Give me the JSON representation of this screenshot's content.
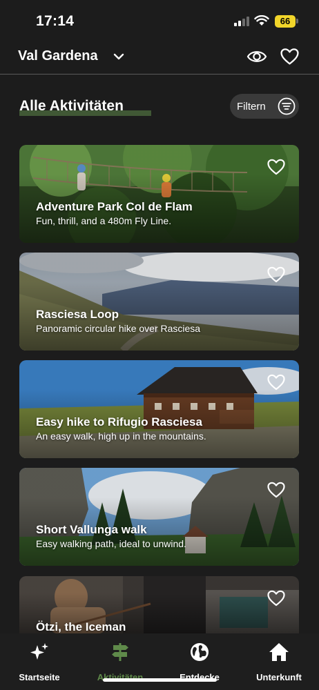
{
  "status_bar": {
    "time": "17:14",
    "battery": "66"
  },
  "header": {
    "location": "Val Gardena"
  },
  "main": {
    "title": "Alle Aktivitäten",
    "filter_label": "Filtern",
    "cards": [
      {
        "title": "Adventure Park Col de Flam",
        "subtitle": "Fun, thrill, and a 480m Fly Line."
      },
      {
        "title": "Rasciesa Loop",
        "subtitle": "Panoramic circular hike over Rasciesa"
      },
      {
        "title": "Easy hike to Rifugio Rasciesa",
        "subtitle": "An easy walk, high up in the mountains."
      },
      {
        "title": "Short Vallunga walk",
        "subtitle": "Easy walking path, ideal to unwind."
      },
      {
        "title": "Ötzi, the Iceman",
        "subtitle": ""
      }
    ]
  },
  "nav": {
    "items": [
      {
        "label": "Startseite",
        "icon": "sparkle-icon"
      },
      {
        "label": "Aktivitäten",
        "icon": "signpost-icon",
        "active": true
      },
      {
        "label": "Entdecke",
        "icon": "globe-icon"
      },
      {
        "label": "Unterkunft",
        "icon": "house-icon"
      }
    ]
  },
  "colors": {
    "background": "#1c1c1c",
    "accent": "#5f8a4a",
    "battery": "#f1d52a"
  }
}
